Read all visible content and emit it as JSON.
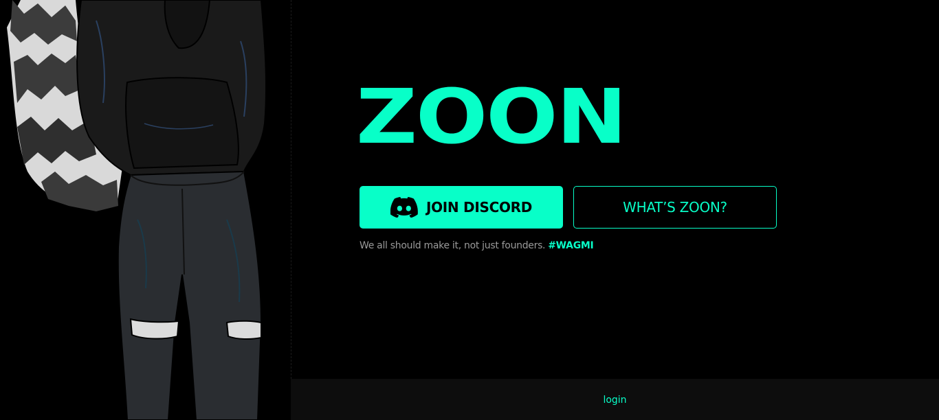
{
  "brand": {
    "logo_text": "ZOON",
    "accent_color": "#08FFC8",
    "background_color": "#000000"
  },
  "hero": {
    "join_discord_label": "JOIN DISCORD",
    "whats_zoon_label": "WHAT’S ZOON?",
    "tagline": "We all should make it, not just founders.",
    "hashtag": "#WAGMI"
  },
  "footer": {
    "login_label": "login"
  },
  "icons": {
    "discord": "discord-icon"
  }
}
